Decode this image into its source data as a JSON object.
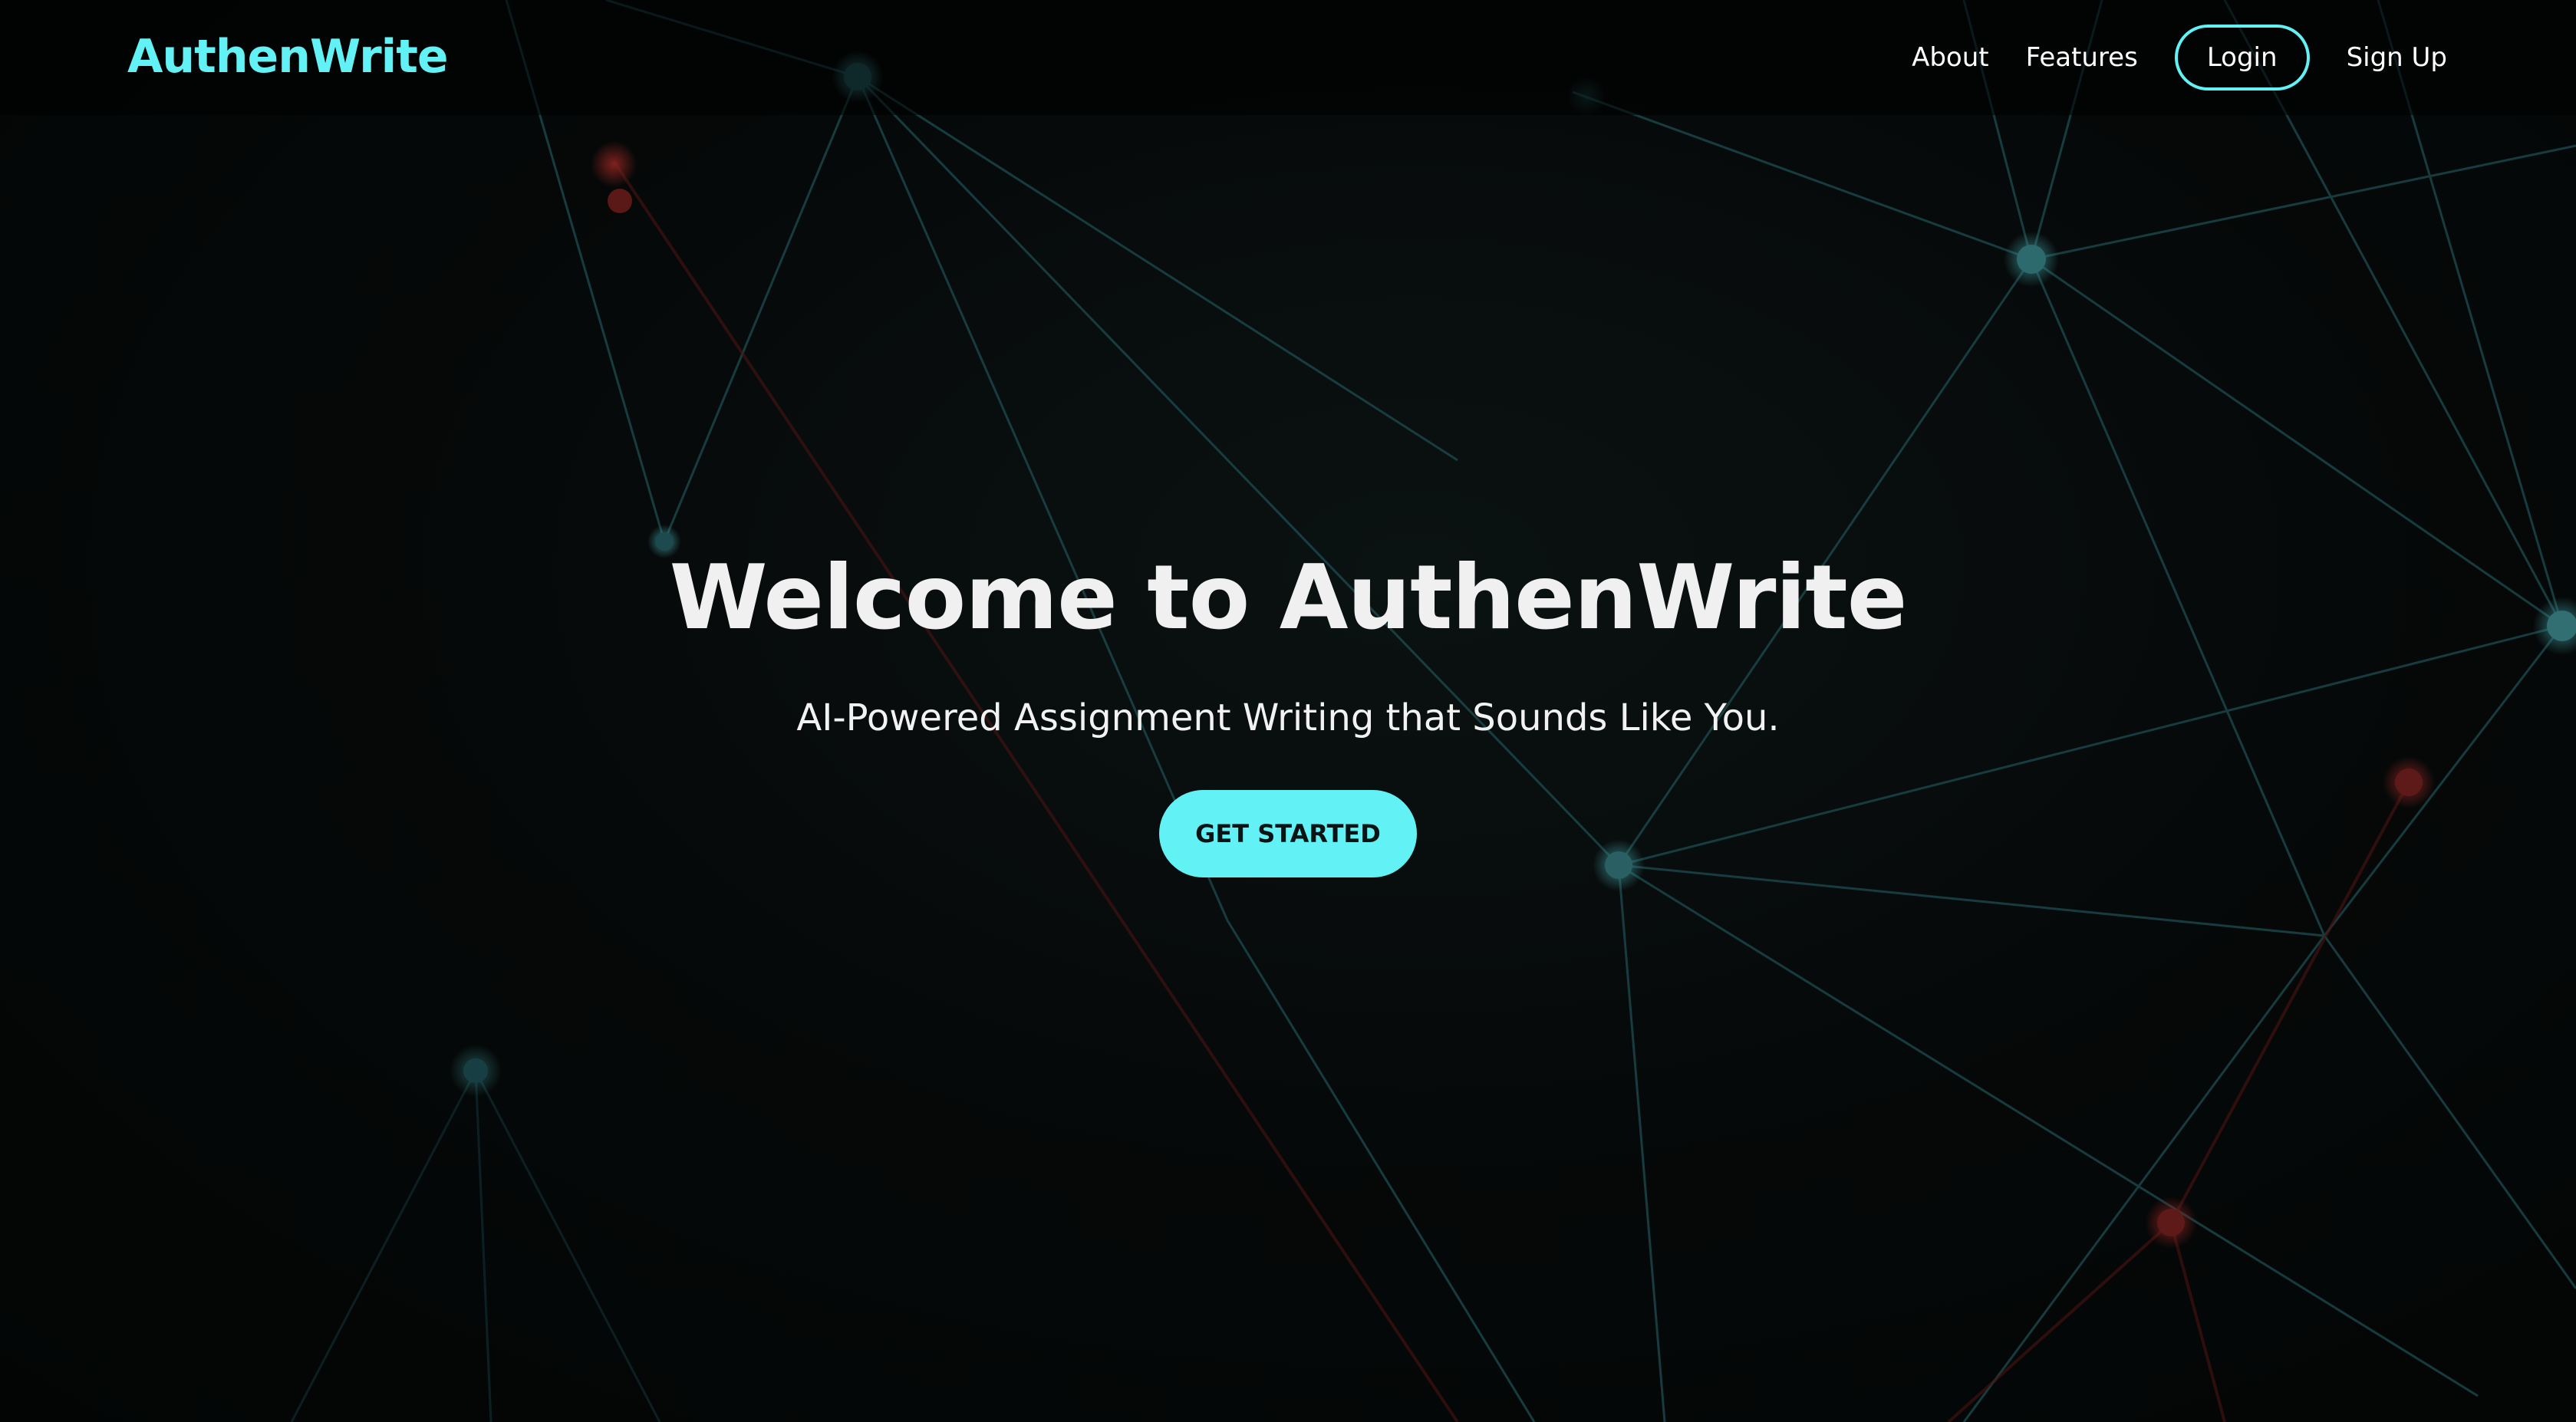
{
  "brand": {
    "name": "AuthenWrite",
    "accent_color": "#62f2f5"
  },
  "nav": {
    "about": "About",
    "features": "Features",
    "login": "Login",
    "signup": "Sign Up"
  },
  "hero": {
    "title": "Welcome to AuthenWrite",
    "subtitle": "AI-Powered Assignment Writing that Sounds Like You.",
    "cta_label": "GET STARTED"
  },
  "background": {
    "style": "network-graph",
    "line_color": "#1f5a5e",
    "node_color": "#2a6b70",
    "warm_node_color": "#6a1a18"
  }
}
